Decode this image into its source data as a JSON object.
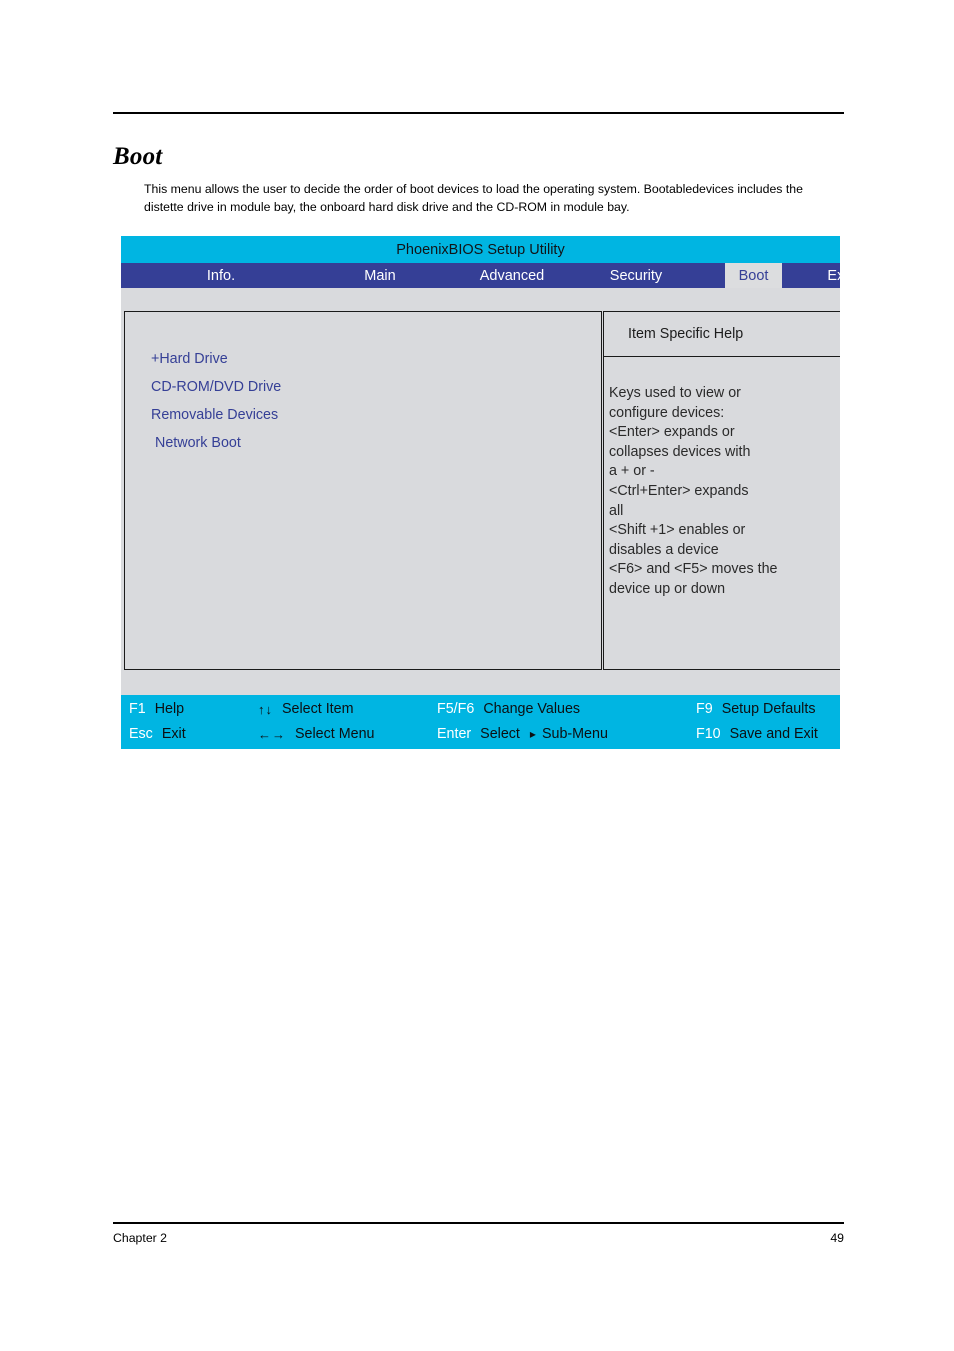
{
  "document": {
    "heading": "Boot",
    "intro": "This menu allows the user to decide the order of boot devices to load the operating system. Bootabledevices includes the distette drive in module bay, the onboard hard disk drive and the CD-ROM in module bay.",
    "footer_left": "Chapter 2",
    "footer_page": "49"
  },
  "bios": {
    "title": "PhoenixBIOS Setup Utility",
    "menu_tabs": [
      {
        "label": "Info.",
        "active": false
      },
      {
        "label": "Main",
        "active": false
      },
      {
        "label": "Advanced",
        "active": false
      },
      {
        "label": "Security",
        "active": false
      },
      {
        "label": "Boot",
        "active": true
      },
      {
        "label": "Exit",
        "active": false
      }
    ],
    "boot_items": [
      {
        "label": "+Hard Drive"
      },
      {
        "label": "CD-ROM/DVD Drive"
      },
      {
        "label": "Removable Devices"
      },
      {
        "label": "Network Boot"
      }
    ],
    "help": {
      "header": "Item Specific Help",
      "lines": [
        "Keys used to view or",
        "configure devices:",
        "<Enter> expands or",
        "collapses devices with",
        "a + or -",
        "<Ctrl+Enter> expands",
        "all",
        "<Shift +1> enables or",
        "disables a device",
        "<F6> and <F5> moves the",
        "device up or down"
      ]
    },
    "keys": {
      "row1": [
        {
          "name": "F1",
          "desc": "Help"
        },
        {
          "glyph": "↑↓",
          "desc": "Select Item"
        },
        {
          "name": "F5/F6",
          "desc": "Change Values"
        },
        {
          "name": "F9",
          "desc": "Setup Defaults"
        }
      ],
      "row2": [
        {
          "name": "Esc",
          "desc": "Exit"
        },
        {
          "glyph": "←→",
          "desc": "Select Menu"
        },
        {
          "name": "Enter",
          "desc": "Select",
          "desc2": "Sub-Menu",
          "arrow": "▸"
        },
        {
          "name": "F10",
          "desc": "Save and Exit"
        }
      ]
    }
  },
  "colors": {
    "title_bar": "#00b5e2",
    "menu_bar": "#353f96",
    "panel_bg": "#d9dadd",
    "boot_item_text": "#353f96",
    "active_tab_bg": "#dcdddf"
  }
}
